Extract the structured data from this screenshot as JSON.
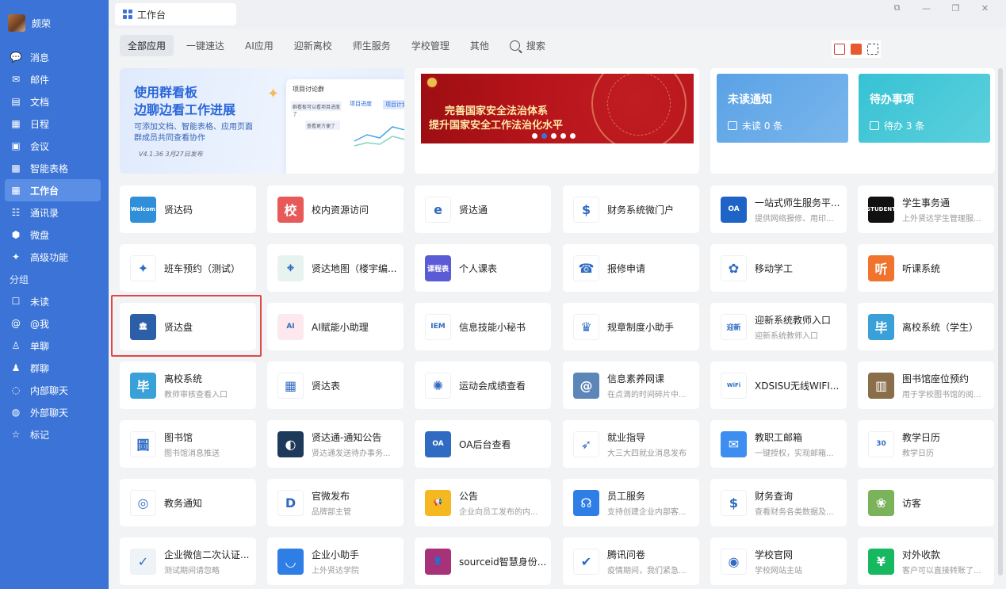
{
  "profile": {
    "name": "颇荣"
  },
  "sidebar": {
    "items": [
      {
        "label": "消息",
        "icon": "message-icon"
      },
      {
        "label": "邮件",
        "icon": "mail-icon"
      },
      {
        "label": "文档",
        "icon": "document-icon"
      },
      {
        "label": "日程",
        "icon": "calendar-icon"
      },
      {
        "label": "会议",
        "icon": "meeting-icon"
      },
      {
        "label": "智能表格",
        "icon": "smart-table-icon"
      },
      {
        "label": "工作台",
        "icon": "workbench-icon",
        "active": true
      },
      {
        "label": "通讯录",
        "icon": "contacts-icon"
      },
      {
        "label": "微盘",
        "icon": "drive-icon"
      },
      {
        "label": "高级功能",
        "icon": "advanced-icon"
      }
    ],
    "section": "分组",
    "groups": [
      {
        "label": "未读",
        "icon": "unread-icon"
      },
      {
        "label": "@我",
        "icon": "mention-icon"
      },
      {
        "label": "单聊",
        "icon": "single-chat-icon"
      },
      {
        "label": "群聊",
        "icon": "group-chat-icon"
      },
      {
        "label": "内部聊天",
        "icon": "internal-chat-icon"
      },
      {
        "label": "外部聊天",
        "icon": "external-chat-icon"
      },
      {
        "label": "标记",
        "icon": "star-icon"
      }
    ]
  },
  "titlebar": {
    "tab": "工作台"
  },
  "categories": [
    "全部应用",
    "一键速达",
    "AI应用",
    "迎新离校",
    "师生服务",
    "学校管理",
    "其他",
    "搜索"
  ],
  "promo": {
    "title1": "使用群看板",
    "title2": "边聊边看工作进展",
    "desc1": "可添加文档、智能表格、应用页面",
    "desc2": "群成员共同查看协作",
    "version": "V4.1.36 3月27日发布",
    "mock_header": "项目讨论群",
    "mock_tab1": "项目进度",
    "mock_tab2": "项目计划",
    "mock_msg1": "群看板可以看项目进度了",
    "mock_msg2": "查看更方便了"
  },
  "banner": {
    "line1": "完善国家安全法治体系",
    "line2": "提升国家安全工作法治化水平"
  },
  "notices": {
    "unread_title": "未读通知",
    "unread_count": "未读 0 条",
    "todo_title": "待办事项",
    "todo_count": "待办 3 条"
  },
  "apps": [
    {
      "name": "贤达码",
      "desc": "",
      "color": "#2f8fd8",
      "glyph": "Welcom"
    },
    {
      "name": "校内资源访问",
      "desc": "",
      "color": "#e85a5a",
      "glyph": "校"
    },
    {
      "name": "贤达通",
      "desc": "",
      "color": "#ffffff",
      "glyph": "e"
    },
    {
      "name": "财务系统微门户",
      "desc": "",
      "color": "#ffffff",
      "glyph": "$"
    },
    {
      "name": "一站式师生服务平...",
      "desc": "提供网络报修、用印...",
      "color": "#1e63c6",
      "glyph": "OA"
    },
    {
      "name": "学生事务通",
      "desc": "上外贤达学生管理服...",
      "color": "#111111",
      "glyph": "STUDENT"
    },
    {
      "name": "班车预约（测试）",
      "desc": "",
      "color": "#ffffff",
      "glyph": "✦"
    },
    {
      "name": "贤达地图（楼宇编...",
      "desc": "",
      "color": "#e6f3ee",
      "glyph": "⌖"
    },
    {
      "name": "个人课表",
      "desc": "",
      "color": "#5b5bd6",
      "glyph": "课程表"
    },
    {
      "name": "报修申请",
      "desc": "",
      "color": "#ffffff",
      "glyph": "☎"
    },
    {
      "name": "移动学工",
      "desc": "",
      "color": "#ffffff",
      "glyph": "✿"
    },
    {
      "name": "听课系统",
      "desc": "",
      "color": "#f0742e",
      "glyph": "听"
    },
    {
      "name": "贤达盘",
      "desc": "",
      "color": "#2c5fa8",
      "glyph": "🏛"
    },
    {
      "name": "AI赋能小助理",
      "desc": "",
      "color": "#ffe7ee",
      "glyph": "AI"
    },
    {
      "name": "信息技能小秘书",
      "desc": "",
      "color": "#ffffff",
      "glyph": "IEM"
    },
    {
      "name": "规章制度小助手",
      "desc": "",
      "color": "#ffffff",
      "glyph": "♛"
    },
    {
      "name": "迎新系统教师入口",
      "desc": "迎新系统教师入口",
      "color": "#ffffff",
      "glyph": "迎新"
    },
    {
      "name": "离校系统（学生）",
      "desc": "",
      "color": "#3aa0d8",
      "glyph": "毕"
    },
    {
      "name": "离校系统",
      "desc": "教师审核查看入口",
      "color": "#3aa0d8",
      "glyph": "毕"
    },
    {
      "name": "贤达表",
      "desc": "",
      "color": "#ffffff",
      "glyph": "▦"
    },
    {
      "name": "运动会成绩查看",
      "desc": "",
      "color": "#ffffff",
      "glyph": "✺"
    },
    {
      "name": "信息素养网课",
      "desc": "在点滴的时间碎片中...",
      "color": "#5d86b8",
      "glyph": "@"
    },
    {
      "name": "XDSISU无线WIFI...",
      "desc": "",
      "color": "#ffffff",
      "glyph": "WiFi"
    },
    {
      "name": "图书馆座位预约",
      "desc": "用于学校图书馆的阅...",
      "color": "#8a6e4a",
      "glyph": "▥"
    },
    {
      "name": "图书馆",
      "desc": "图书馆消息推送",
      "color": "#ffffff",
      "glyph": "圖"
    },
    {
      "name": "贤达通-通知公告",
      "desc": "贤达通发送待办事务...",
      "color": "#1e3a5a",
      "glyph": "◐"
    },
    {
      "name": "OA后台查看",
      "desc": "",
      "color": "#2f6bc2",
      "glyph": "OA"
    },
    {
      "name": "就业指导",
      "desc": "大三大四就业消息发布",
      "color": "#ffffff",
      "glyph": "➶"
    },
    {
      "name": "教职工邮箱",
      "desc": "一键授权，实现邮箱...",
      "color": "#3d8ef0",
      "glyph": "✉"
    },
    {
      "name": "教学日历",
      "desc": "教学日历",
      "color": "#ffffff",
      "glyph": "30"
    },
    {
      "name": "教务通知",
      "desc": "",
      "color": "#ffffff",
      "glyph": "◎"
    },
    {
      "name": "官微发布",
      "desc": "品牌部主管",
      "color": "#ffffff",
      "glyph": "D"
    },
    {
      "name": "公告",
      "desc": "企业向员工发布的内...",
      "color": "#f5b820",
      "glyph": "📢"
    },
    {
      "name": "员工服务",
      "desc": "支持创建企业内部客...",
      "color": "#2f7ee6",
      "glyph": "☊"
    },
    {
      "name": "财务查询",
      "desc": "查看财务各类数据及...",
      "color": "#ffffff",
      "glyph": "$"
    },
    {
      "name": "访客",
      "desc": "",
      "color": "#7bb35a",
      "glyph": "❀"
    },
    {
      "name": "企业微信二次认证...",
      "desc": "测试期间请忽略",
      "color": "#eef3f8",
      "glyph": "✓"
    },
    {
      "name": "企业小助手",
      "desc": "上外贤达学院",
      "color": "#2f7ee6",
      "glyph": "◡"
    },
    {
      "name": "sourceid智慧身份...",
      "desc": "",
      "color": "#a8327a",
      "glyph": "👤"
    },
    {
      "name": "腾讯问卷",
      "desc": "疫情期间，我们紧急...",
      "color": "#ffffff",
      "glyph": "✔"
    },
    {
      "name": "学校官网",
      "desc": "学校网站主站",
      "color": "#ffffff",
      "glyph": "◉"
    },
    {
      "name": "对外收款",
      "desc": "客户可以直接转账了...",
      "color": "#17b860",
      "glyph": "¥"
    }
  ]
}
